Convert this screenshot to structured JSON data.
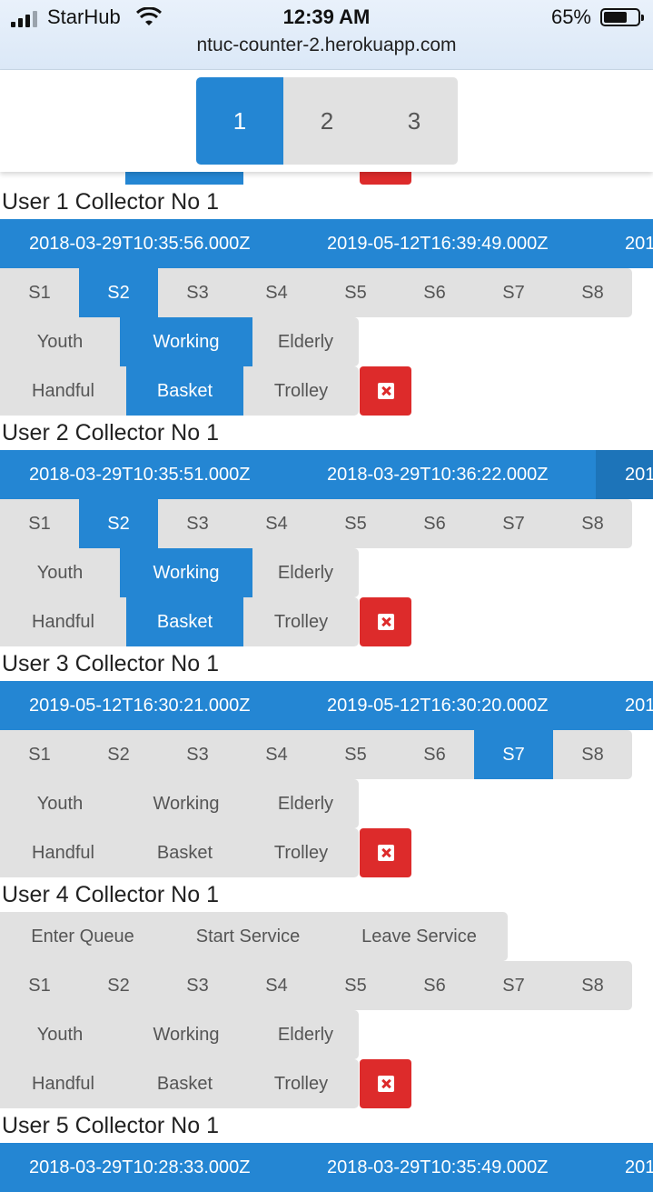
{
  "status": {
    "carrier": "StarHub",
    "time": "12:39 AM",
    "battery": "65%",
    "battery_level": 0.65,
    "url": "ntuc-counter-2.herokuapp.com"
  },
  "pager": {
    "tabs": [
      "1",
      "2",
      "3"
    ],
    "active": "1"
  },
  "users": [
    {
      "title": "User 1 Collector No 1",
      "timestamps": [
        "2018-03-29T10:35:56.000Z",
        "2019-05-12T16:39:49.000Z",
        "201"
      ],
      "stations": [
        "S1",
        "S2",
        "S3",
        "S4",
        "S5",
        "S6",
        "S7",
        "S8"
      ],
      "active_station": "S2",
      "ages": [
        "Youth",
        "Working",
        "Elderly"
      ],
      "active_age": "Working",
      "baskets": [
        "Handful",
        "Basket",
        "Trolley"
      ],
      "active_basket": "Basket"
    },
    {
      "title": "User 2 Collector No 1",
      "timestamps": [
        "2018-03-29T10:35:51.000Z",
        "2018-03-29T10:36:22.000Z",
        "201"
      ],
      "stations": [
        "S1",
        "S2",
        "S3",
        "S4",
        "S5",
        "S6",
        "S7",
        "S8"
      ],
      "active_station": "S2",
      "ages": [
        "Youth",
        "Working",
        "Elderly"
      ],
      "active_age": "Working",
      "baskets": [
        "Handful",
        "Basket",
        "Trolley"
      ],
      "active_basket": "Basket"
    },
    {
      "title": "User 3 Collector No 1",
      "timestamps": [
        "2019-05-12T16:30:21.000Z",
        "2019-05-12T16:30:20.000Z",
        "201"
      ],
      "stations": [
        "S1",
        "S2",
        "S3",
        "S4",
        "S5",
        "S6",
        "S7",
        "S8"
      ],
      "active_station": "S7",
      "ages": [
        "Youth",
        "Working",
        "Elderly"
      ],
      "active_age": "",
      "baskets": [
        "Handful",
        "Basket",
        "Trolley"
      ],
      "active_basket": ""
    },
    {
      "title": "User 4 Collector No 1",
      "queue_actions": [
        "Enter Queue",
        "Start Service",
        "Leave Service"
      ],
      "stations": [
        "S1",
        "S2",
        "S3",
        "S4",
        "S5",
        "S6",
        "S7",
        "S8"
      ],
      "active_station": "",
      "ages": [
        "Youth",
        "Working",
        "Elderly"
      ],
      "active_age": "",
      "baskets": [
        "Handful",
        "Basket",
        "Trolley"
      ],
      "active_basket": ""
    },
    {
      "title": "User 5 Collector No 1",
      "timestamps": [
        "2018-03-29T10:28:33.000Z",
        "2018-03-29T10:35:49.000Z",
        "201"
      ]
    }
  ],
  "icons": {
    "delete": "close-square-icon",
    "wifi": "wifi-icon",
    "signal": "signal-icon",
    "battery": "battery-icon"
  },
  "colors": {
    "primary": "#2486d3",
    "danger": "#dd2b2b",
    "neutral": "#e1e1e1"
  }
}
